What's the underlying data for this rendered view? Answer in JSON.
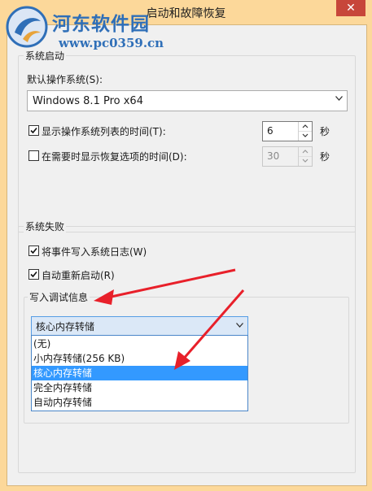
{
  "window": {
    "title": "启动和故障恢复",
    "close_label": "✕"
  },
  "watermark": {
    "site": "河东软件园",
    "url": "www.pc0359.cn"
  },
  "system_startup": {
    "legend": "系统启动",
    "default_os_label": "默认操作系统(S):",
    "default_os_value": "Windows 8.1 Pro x64",
    "show_os_list": {
      "label": "显示操作系统列表的时间(T):",
      "checked": true,
      "value": "6",
      "unit": "秒"
    },
    "show_recovery": {
      "label": "在需要时显示恢复选项的时间(D):",
      "checked": false,
      "value": "30",
      "unit": "秒"
    }
  },
  "system_failure": {
    "legend": "系统失败",
    "write_event_log": {
      "label": "将事件写入系统日志(W)",
      "checked": true
    },
    "auto_restart": {
      "label": "自动重新启动(R)",
      "checked": true
    },
    "debug_info": {
      "legend": "写入调试信息",
      "selected": "核心内存转储",
      "options": [
        "(无)",
        "小内存转储(256 KB)",
        "核心内存转储",
        "完全内存转储",
        "自动内存转储"
      ]
    }
  },
  "colors": {
    "accent": "#3399ff",
    "arrow": "#e8202a",
    "title_bar": "#fcd89a",
    "watermark": "#2f6fb8"
  }
}
